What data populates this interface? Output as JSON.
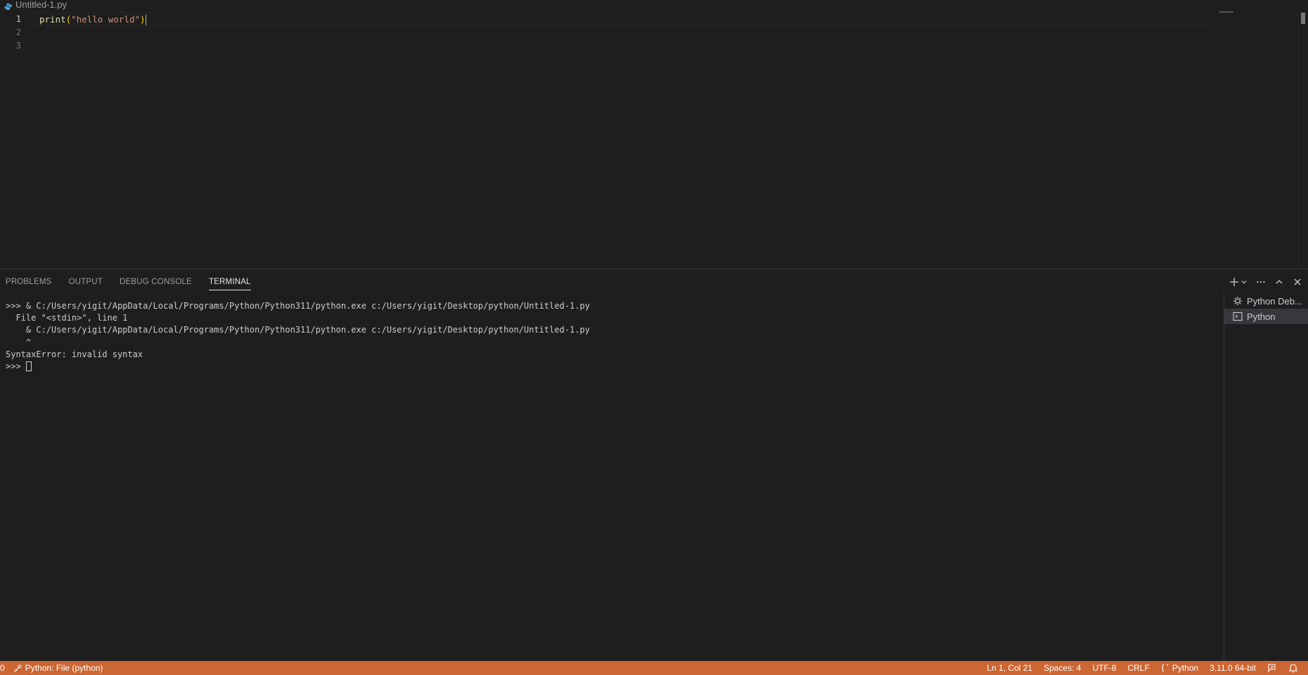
{
  "editor_tab": {
    "filename": "Untitled-1.py",
    "icon": "python-file-icon"
  },
  "editor": {
    "lines": [
      {
        "number": "1",
        "fn": "print",
        "open": "(",
        "str": "\"hello world\"",
        "close": ")"
      },
      {
        "number": "2"
      },
      {
        "number": "3"
      }
    ]
  },
  "panel": {
    "tabs": [
      "PROBLEMS",
      "OUTPUT",
      "DEBUG CONSOLE",
      "TERMINAL"
    ],
    "active_tab": "TERMINAL",
    "actions": [
      "new-terminal-icon",
      "chevron-down-icon",
      "more-icon",
      "maximize-icon",
      "close-icon"
    ]
  },
  "terminal": {
    "lines": [
      ">>> & C:/Users/yigit/AppData/Local/Programs/Python/Python311/python.exe c:/Users/yigit/Desktop/python/Untitled-1.py",
      "  File \"<stdin>\", line 1",
      "    & C:/Users/yigit/AppData/Local/Programs/Python/Python311/python.exe c:/Users/yigit/Desktop/python/Untitled-1.py",
      "    ^",
      "SyntaxError: invalid syntax"
    ],
    "prompt": ">>> "
  },
  "terminal_list": [
    {
      "label": "Python Deb...",
      "icon": "debug-gear-icon",
      "selected": false
    },
    {
      "label": "Python",
      "icon": "terminal-icon",
      "selected": true
    }
  ],
  "statusbar": {
    "color": "#cc6633",
    "left": {
      "zero": "0",
      "debug_label": "Python: File (python)"
    },
    "right": {
      "position": "Ln 1, Col 21",
      "spaces": "Spaces: 4",
      "encoding": "UTF-8",
      "eol": "CRLF",
      "language": "Python",
      "interpreter": "3.11.0 64-bit"
    }
  }
}
